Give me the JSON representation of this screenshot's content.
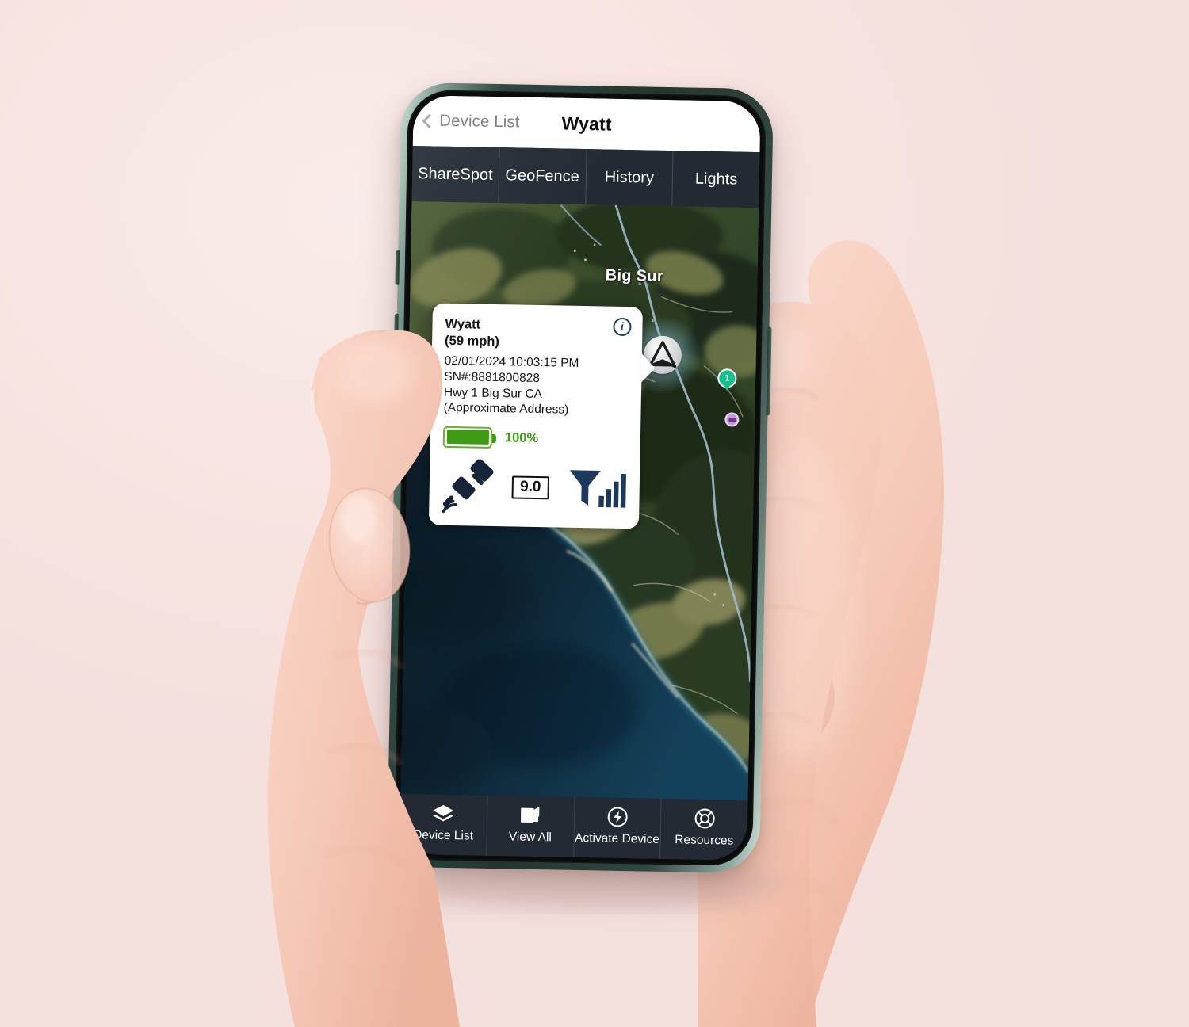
{
  "background": {
    "color": "#f8e7e4"
  },
  "device": {
    "frame_color": "#2a3e37",
    "screen_bg": "#0d1117"
  },
  "header": {
    "back_label": "Device List",
    "title": "Wyatt",
    "back_icon": "chevron-left-icon"
  },
  "tabs": [
    {
      "label": "ShareSpot"
    },
    {
      "label": "GeoFence"
    },
    {
      "label": "History"
    },
    {
      "label": "Lights"
    }
  ],
  "map": {
    "place_label": "Big Sur",
    "vehicle_marker_icon": "navigation-arrow-icon",
    "cluster_badge": "1",
    "stop_marker_icon": "parking-pin-icon",
    "style": "satellite"
  },
  "callout": {
    "device_name": "Wyatt",
    "speed": "(59 mph)",
    "timestamp": "02/01/2024 10:03:15 PM",
    "serial": "SN#:8881800828",
    "address": "Hwy 1 Big Sur CA",
    "address_note": "(Approximate Address)",
    "info_icon": "info-circle-icon",
    "info_glyph": "i",
    "battery": {
      "percent_label": "100%",
      "fill_percent": 100,
      "color": "#3d9a14",
      "icon": "battery-icon"
    },
    "gps": {
      "satellite_icon": "satellite-icon",
      "hdop_value": "9.0"
    },
    "signal": {
      "icon": "cell-signal-icon",
      "bars": 4
    }
  },
  "bottom_nav": [
    {
      "label": "Device List",
      "icon": "layers-icon"
    },
    {
      "label": "View All",
      "icon": "map-folded-icon"
    },
    {
      "label": "Activate Device",
      "icon": "bolt-circle-icon"
    },
    {
      "label": "Resources",
      "icon": "lifebuoy-icon"
    }
  ]
}
